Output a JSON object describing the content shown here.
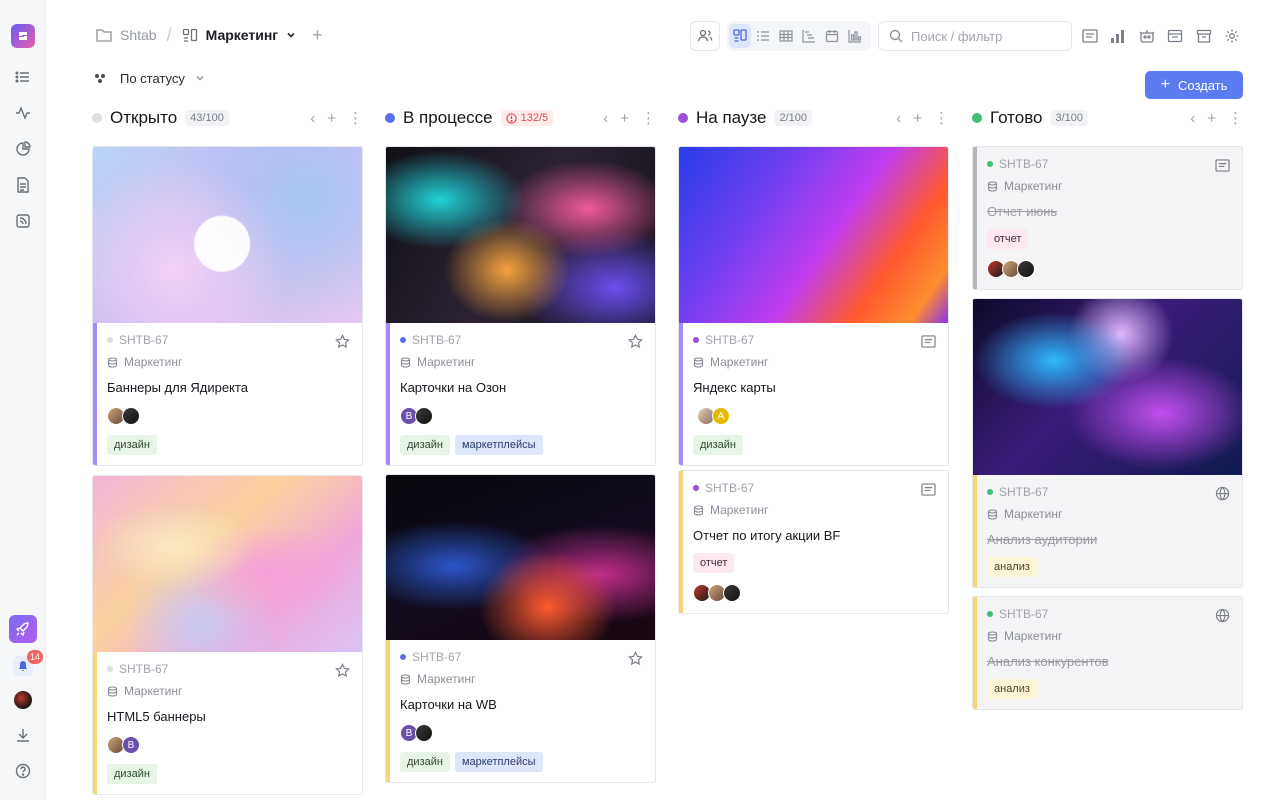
{
  "breadcrumb": {
    "root": "Shtab",
    "current": "Маркетинг"
  },
  "search": {
    "placeholder": "Поиск / фильтр"
  },
  "groupby": {
    "label": "По статусу"
  },
  "create_button": {
    "label": "Создать"
  },
  "notifications": {
    "count": "14"
  },
  "colors": {
    "accent": "#5b7cf0",
    "open": "#e0e0e4",
    "progress": "#5b6ff0",
    "paused": "#9b4fd6",
    "done": "#3dbf7a"
  },
  "columns": [
    {
      "title": "Открыто",
      "count": "43/100",
      "cards": [
        {
          "id": "SHTB-67",
          "project": "Маркетинг",
          "title": "Баннеры для Ядиректа",
          "tags": [
            "дизайн"
          ]
        },
        {
          "id": "SHTB-67",
          "project": "Маркетинг",
          "title": "HTML5 баннеры",
          "avatar_letter": "B",
          "tags": [
            "дизайн"
          ]
        }
      ]
    },
    {
      "title": "В процессе",
      "count": "132/5",
      "cards": [
        {
          "id": "SHTB-67",
          "project": "Маркетинг",
          "title": "Карточки на Озон",
          "avatar_letter": "B",
          "tags": [
            "дизайн",
            "маркетплейсы"
          ]
        },
        {
          "id": "SHTB-67",
          "project": "Маркетинг",
          "title": "Карточки на WB",
          "avatar_letter": "B",
          "tags": [
            "дизайн",
            "маркетплейсы"
          ]
        }
      ]
    },
    {
      "title": "На паузе",
      "count": "2/100",
      "cards": [
        {
          "id": "SHTB-67",
          "project": "Маркетинг",
          "title": "Яндекс карты",
          "avatar_letter": "A",
          "tags": [
            "дизайн"
          ]
        },
        {
          "id": "SHTB-67",
          "project": "Маркетинг",
          "title": "Отчет по итогу акции BF",
          "tags": [
            "отчет"
          ]
        }
      ]
    },
    {
      "title": "Готово",
      "count": "3/100",
      "cards": [
        {
          "id": "SHTB-67",
          "project": "Маркетинг",
          "title": "Отчет июнь",
          "tags": [
            "отчет"
          ]
        },
        {
          "id": "SHTB-67",
          "project": "Маркетинг",
          "title": "Анализ аудитории",
          "tags": [
            "анализ"
          ]
        },
        {
          "id": "SHTB-67",
          "project": "Маркетинг",
          "title": "Анализ конкурентов",
          "tags": [
            "анализ"
          ]
        }
      ]
    }
  ]
}
